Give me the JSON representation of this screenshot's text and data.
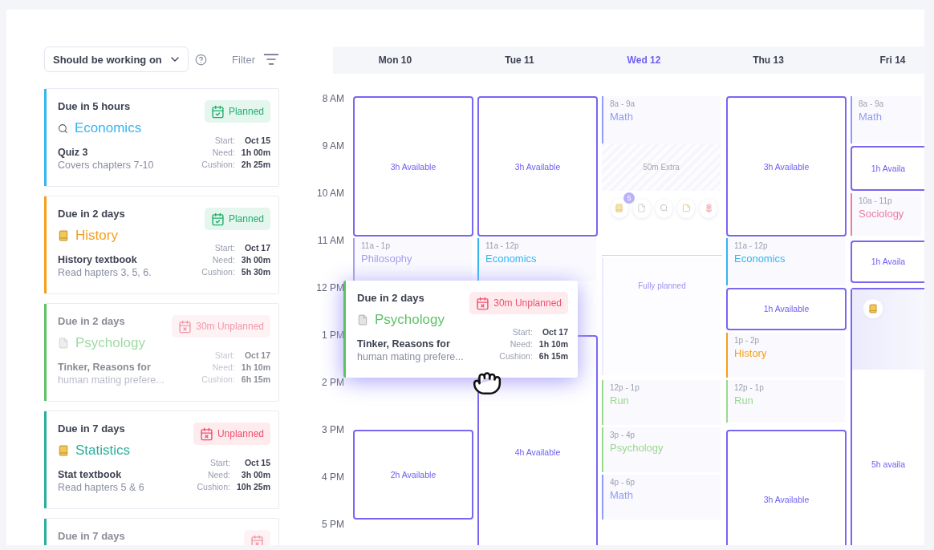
{
  "toolbar": {
    "dropdown": "Should be working on",
    "filter": "Filter"
  },
  "tasks": [
    {
      "due": "Due in 5 hours",
      "kind": "search",
      "subject": "Economics",
      "color": "#35b5ef",
      "status": {
        "kind": "planned",
        "label": "Planned"
      },
      "title": "Quiz 3",
      "note": "Covers chapters 7-10",
      "faded": false,
      "stats": [
        {
          "label": "Start:",
          "value": "Oct 15"
        },
        {
          "label": "Need:",
          "value": "1h 00m"
        },
        {
          "label": "Cushion:",
          "value": "2h 25m"
        }
      ]
    },
    {
      "due": "Due in 2 days",
      "kind": "book",
      "subject": "History",
      "color": "#f59e1b",
      "status": {
        "kind": "planned",
        "label": "Planned"
      },
      "title": "History textbook",
      "note": "Read hapters 3, 5, 6.",
      "faded": false,
      "stats": [
        {
          "label": "Start:",
          "value": "Oct 17"
        },
        {
          "label": "Need:",
          "value": "3h 00m"
        },
        {
          "label": "Cushion:",
          "value": "5h 30m"
        }
      ]
    },
    {
      "due": "Due in 2 days",
      "kind": "document",
      "subject": "Psychology",
      "color": "#5cc264",
      "status": {
        "kind": "unplanned",
        "label": "30m Unplanned"
      },
      "title": "Tinker, Reasons for",
      "note": "human mating prefere...",
      "faded": true,
      "stats": [
        {
          "label": "Start:",
          "value": "Oct 17"
        },
        {
          "label": "Need:",
          "value": "1h 10m"
        },
        {
          "label": "Cushion:",
          "value": "6h 15m"
        }
      ]
    },
    {
      "due": "Due in 7 days",
      "kind": "book",
      "subject": "Statistics",
      "color": "#2aae9c",
      "status": {
        "kind": "unplanned",
        "label": "Unplanned"
      },
      "title": "Stat textbook",
      "note": "Read hapters 5 & 6",
      "faded": false,
      "stats": [
        {
          "label": "Start:",
          "value": "Oct 15"
        },
        {
          "label": "Need:",
          "value": "3h 00m"
        },
        {
          "label": "Cushion:",
          "value": "10h 25m"
        }
      ]
    },
    {
      "due": "Due in 7 days",
      "color": "#2aae9c",
      "status": {
        "kind": "unplanned"
      },
      "faded": true
    }
  ],
  "days": [
    {
      "label": "Mon 10",
      "selected": false
    },
    {
      "label": "Tue 11",
      "selected": false
    },
    {
      "label": "Wed 12",
      "selected": true
    },
    {
      "label": "Thu 13",
      "selected": false
    },
    {
      "label": "Fri 14",
      "selected": false
    }
  ],
  "hours": [
    "8 AM",
    "9 AM",
    "10 AM",
    "11 AM",
    "12 PM",
    "1 PM",
    "2 PM",
    "3 PM",
    "4 PM",
    "5 PM"
  ],
  "columns": [
    {
      "blocks": [
        {
          "kind": "available",
          "label": "3h Available"
        },
        {
          "kind": "event",
          "time": "11a - 1p",
          "subject": "Philosophy",
          "color": "#a79ef0"
        },
        {
          "kind": "available",
          "label": "2h Available"
        }
      ]
    },
    {
      "blocks": [
        {
          "kind": "available",
          "label": "3h Available"
        },
        {
          "kind": "event",
          "time": "11a - 12p",
          "subject": "Economics",
          "color": "#35b5ef"
        },
        {
          "kind": "available",
          "label": "4h Available"
        }
      ]
    },
    {
      "blocks": [
        {
          "kind": "event",
          "time": "8a - 9a",
          "subject": "Math",
          "color": "#8f9cf5"
        },
        {
          "kind": "extra",
          "label": "50m Extra"
        },
        {
          "kind": "icons",
          "count": "5"
        },
        {
          "kind": "now"
        },
        {
          "kind": "fully",
          "label": "Fully planned"
        },
        {
          "kind": "event",
          "time": "12p - 1p",
          "subject": "Run",
          "color": "#9bd88e"
        },
        {
          "kind": "event",
          "time": "3p - 4p",
          "subject": "Psychology",
          "color": "#9bd88e"
        },
        {
          "kind": "event",
          "time": "4p - 6p",
          "subject": "Math",
          "color": "#8f9cf5"
        }
      ]
    },
    {
      "blocks": [
        {
          "kind": "available",
          "label": "3h Available"
        },
        {
          "kind": "event",
          "time": "11a - 12p",
          "subject": "Economics",
          "color": "#35b5ef"
        },
        {
          "kind": "available",
          "label": "1h Available"
        },
        {
          "kind": "event",
          "time": "1p - 2p",
          "subject": "History",
          "color": "#f59e1b"
        },
        {
          "kind": "event",
          "time": "12p - 1p",
          "subject": "Run",
          "color": "#9bd88e"
        },
        {
          "kind": "available",
          "label": "3h Available"
        }
      ]
    },
    {
      "blocks": [
        {
          "kind": "event",
          "time": "8a - 9a",
          "subject": "Math",
          "color": "#8f9cf5"
        },
        {
          "kind": "available",
          "label": "1h Availa"
        },
        {
          "kind": "event",
          "time": "10a - 11p",
          "subject": "Sociology",
          "color": "#f07aa0"
        },
        {
          "kind": "available",
          "label": "1h Availa"
        },
        {
          "kind": "available",
          "label": "5h availa"
        },
        {
          "kind": "highlight"
        }
      ]
    }
  ],
  "dragged": {
    "due": "Due in 2 days",
    "kind": "document",
    "subject": "Psychology",
    "color": "#5cc264",
    "status": {
      "kind": "unplanned",
      "label": "30m Unplanned"
    },
    "title": "Tinker, Reasons for",
    "note": "human mating prefere...",
    "stats": [
      {
        "label": "Start:",
        "value": "Oct 17"
      },
      {
        "label": "Need:",
        "value": "1h 10m"
      },
      {
        "label": "Cushion:",
        "value": "6h 15m"
      }
    ]
  }
}
